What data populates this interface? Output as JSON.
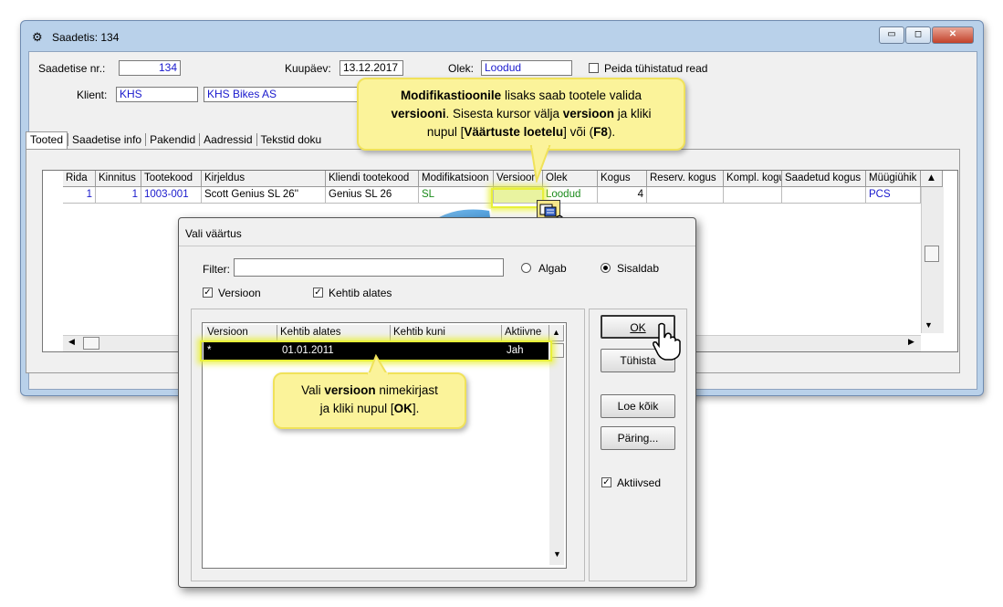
{
  "window": {
    "title": "Saadetis: 134",
    "buttons": {
      "minimize": "▭",
      "maximize": "◻",
      "close": "✕"
    }
  },
  "header": {
    "shipment_no_label": "Saadetise nr.:",
    "shipment_no_value": "134",
    "date_label": "Kuupäev:",
    "date_value": "13.12.2017",
    "status_label": "Olek:",
    "status_value": "Loodud",
    "hide_cancelled_label": "Peida tühistatud read",
    "client_label": "Klient:",
    "client_code": "KHS",
    "client_name": "KHS Bikes AS"
  },
  "tabs": [
    "Tooted",
    "Saadetise info",
    "Pakendid",
    "Aadressid",
    "Tekstid doku"
  ],
  "grid": {
    "columns": [
      "Rida",
      "Kinnitus",
      "Tootekood",
      "Kirjeldus",
      "Kliendi tootekood",
      "Modifikatsioon",
      "Versioon",
      "Olek",
      "Kogus",
      "Reserv. kogus",
      "Kompl. kogus",
      "Saadetud kogus",
      "Müügiühik"
    ],
    "rows": [
      {
        "rida": "1",
        "kinnitus": "1",
        "tootekood": "1003-001",
        "kirjeldus": "Scott Genius SL 26''",
        "kliendi_tootekood": "Genius SL 26",
        "modifikatsioon": "SL",
        "versioon": "",
        "olek": "Loodud",
        "kogus": "4",
        "reserv": "",
        "kompl": "",
        "saadetud": "",
        "uhik": "PCS"
      }
    ]
  },
  "dialog": {
    "title": "Vali väärtus",
    "filter_label": "Filter:",
    "filter_value": "",
    "radio_starts": "Algab",
    "radio_contains": "Sisaldab",
    "check_version": "Versioon",
    "check_valid_from": "Kehtib alates",
    "list_columns": [
      "Versioon",
      "Kehtib alates",
      "Kehtib kuni",
      "Aktiivne"
    ],
    "list_rows": [
      {
        "versioon": "*",
        "alates": "01.01.2011",
        "kuni": "",
        "aktiivne": "Jah"
      }
    ],
    "btn_ok": "OK",
    "btn_cancel": "Tühista",
    "btn_read_all": "Loe kõik",
    "btn_query": "Päring...",
    "check_active": "Aktiivsed"
  },
  "callouts": {
    "top": {
      "l1_b": "Modifikastioonile",
      "l1": " lisaks saab tootele valida",
      "l2_b": "versiooni",
      "l2": ". Sisesta kursor välja ",
      "l2_b2": "versioon",
      "l2_end": " ja kliki",
      "l3": "nupul [",
      "l3_b": "Väärtuste loetelu",
      "l3_mid": "] või (",
      "l3_b2": "F8",
      "l3_end": ")."
    },
    "bottom": {
      "l1": "Vali ",
      "l1_b": "versioon",
      "l1_end": " nimekirjast",
      "l2": "ja kliki nupul [",
      "l2_b": "OK",
      "l2_end": "]."
    }
  },
  "colors": {
    "accent_text": "#1a1acd",
    "status_green": "#1a8a1a",
    "callout": "#fbf39a",
    "highlight": "#e8f03a"
  }
}
